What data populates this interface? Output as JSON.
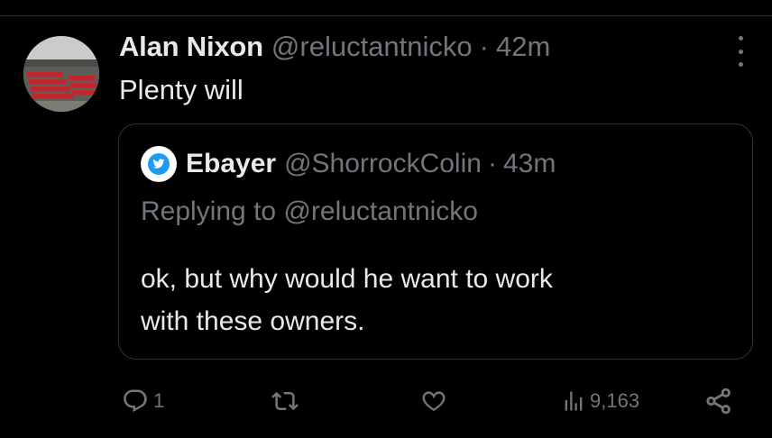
{
  "tweet": {
    "author_name": "Alan Nixon",
    "author_handle": "@reluctantnicko",
    "separator": "·",
    "timestamp": "42m",
    "text": "Plenty will"
  },
  "quote": {
    "author_name": "Ebayer",
    "author_handle": "@ShorrockColin",
    "separator": "·",
    "timestamp": "43m",
    "replying_label": "Replying to",
    "replying_handle": "@reluctantnicko",
    "text_line1": "ok, but why would he want to work",
    "text_line2": "with these owners."
  },
  "actions": {
    "reply_count": "1",
    "views_count": "9,163"
  },
  "icons": {
    "more": "more-vertical-icon",
    "reply": "reply-icon",
    "retweet": "retweet-icon",
    "like": "heart-icon",
    "views": "views-icon",
    "share": "share-icon"
  },
  "colors": {
    "background": "#000000",
    "text": "#e7e9ea",
    "muted": "#71767b",
    "border": "#2f3336",
    "accent": "#1d9bf0"
  }
}
